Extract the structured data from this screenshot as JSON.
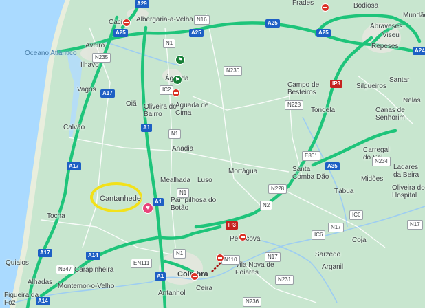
{
  "map": {
    "water_label": "Oceano Atlântico",
    "place_labels": [
      {
        "id": "caci",
        "text": "Caci"
      },
      {
        "id": "albergaria",
        "text": "Albergaria-a-Velha"
      },
      {
        "id": "aveiro",
        "text": "Aveiro"
      },
      {
        "id": "ilhavo",
        "text": "Ílhavo"
      },
      {
        "id": "vagos",
        "text": "Vagos"
      },
      {
        "id": "agueda",
        "text": "Águeda"
      },
      {
        "id": "oia",
        "text": "Oiã"
      },
      {
        "id": "oliveira_bairro",
        "text": "Oliveira do Bairro"
      },
      {
        "id": "aguada_cima",
        "text": "Aguada de Cima"
      },
      {
        "id": "calvao",
        "text": "Calvão"
      },
      {
        "id": "anadia",
        "text": "Anadia"
      },
      {
        "id": "cantanhede",
        "text": "Cantanhede"
      },
      {
        "id": "mealhada",
        "text": "Mealhada"
      },
      {
        "id": "luso",
        "text": "Luso"
      },
      {
        "id": "pampilhosa",
        "text": "Pampilhosa do Botão"
      },
      {
        "id": "mortagua",
        "text": "Mortágua"
      },
      {
        "id": "santa_comba",
        "text": "Santa Comba Dão"
      },
      {
        "id": "tocha",
        "text": "Tocha"
      },
      {
        "id": "penacova",
        "text": "Penacova"
      },
      {
        "id": "carapinheira",
        "text": "Carapinheira"
      },
      {
        "id": "quiaios",
        "text": "Quiaios"
      },
      {
        "id": "alhadas",
        "text": "Alhadas"
      },
      {
        "id": "montemor",
        "text": "Montemor-o-Velho"
      },
      {
        "id": "figueira",
        "text": "Figueira da Foz"
      },
      {
        "id": "coimbra",
        "text": "Coimbra"
      },
      {
        "id": "antanhol",
        "text": "Antanhol"
      },
      {
        "id": "ceira",
        "text": "Ceira"
      },
      {
        "id": "vila_nova",
        "text": "Vila Nova de Poiares"
      },
      {
        "id": "campo_besteiros",
        "text": "Campo de Besteiros"
      },
      {
        "id": "tondela",
        "text": "Tondela"
      },
      {
        "id": "silgueiros",
        "text": "Silgueiros"
      },
      {
        "id": "santar",
        "text": "Santar"
      },
      {
        "id": "nelas",
        "text": "Nelas"
      },
      {
        "id": "canas",
        "text": "Canas de Senhorim"
      },
      {
        "id": "carregal",
        "text": "Carregal do Sal"
      },
      {
        "id": "lagares",
        "text": "Lagares da Beira"
      },
      {
        "id": "oliveira_hospital",
        "text": "Oliveira do Hospital"
      },
      {
        "id": "midoes",
        "text": "Midões"
      },
      {
        "id": "tabua",
        "text": "Tábua"
      },
      {
        "id": "coja",
        "text": "Coja"
      },
      {
        "id": "sarzedo",
        "text": "Sarzedo"
      },
      {
        "id": "arganil",
        "text": "Arganil"
      },
      {
        "id": "bodiosa",
        "text": "Bodiosa"
      },
      {
        "id": "mundao",
        "text": "Mundão"
      },
      {
        "id": "abraveses",
        "text": "Abraveses"
      },
      {
        "id": "viseu",
        "text": "Viseu"
      },
      {
        "id": "repeses",
        "text": "Repeses"
      },
      {
        "id": "frades",
        "text": "Frades"
      }
    ],
    "road_shields": [
      {
        "id": "a29",
        "text": "A29",
        "style": "blue"
      },
      {
        "id": "a25a",
        "text": "A25",
        "style": "blue"
      },
      {
        "id": "a25b",
        "text": "A25",
        "style": "blue"
      },
      {
        "id": "a25c",
        "text": "A25",
        "style": "blue"
      },
      {
        "id": "a25d",
        "text": "A25",
        "style": "blue"
      },
      {
        "id": "a17a",
        "text": "A17",
        "style": "blue"
      },
      {
        "id": "a17b",
        "text": "A17",
        "style": "blue"
      },
      {
        "id": "a17c",
        "text": "A17",
        "style": "blue"
      },
      {
        "id": "a1a",
        "text": "A1",
        "style": "blue"
      },
      {
        "id": "a1b",
        "text": "A1",
        "style": "blue"
      },
      {
        "id": "a1c",
        "text": "A1",
        "style": "blue"
      },
      {
        "id": "a14a",
        "text": "A14",
        "style": "blue"
      },
      {
        "id": "a14b",
        "text": "A14",
        "style": "blue"
      },
      {
        "id": "a35",
        "text": "A35",
        "style": "blue"
      },
      {
        "id": "a24",
        "text": "A24",
        "style": "blue"
      },
      {
        "id": "ip3a",
        "text": "IP3",
        "style": "red"
      },
      {
        "id": "ip3b",
        "text": "IP3",
        "style": "red"
      },
      {
        "id": "n1a",
        "text": "N1",
        "style": "white"
      },
      {
        "id": "n1b",
        "text": "N1",
        "style": "white"
      },
      {
        "id": "n1c",
        "text": "N1",
        "style": "white"
      },
      {
        "id": "n1d",
        "text": "N1",
        "style": "white"
      },
      {
        "id": "n16",
        "text": "N16",
        "style": "white"
      },
      {
        "id": "n235",
        "text": "N235",
        "style": "white"
      },
      {
        "id": "n230",
        "text": "N230",
        "style": "white"
      },
      {
        "id": "ic2",
        "text": "IC2",
        "style": "white"
      },
      {
        "id": "n228a",
        "text": "N228",
        "style": "white"
      },
      {
        "id": "n228b",
        "text": "N228",
        "style": "white"
      },
      {
        "id": "e801",
        "text": "E801",
        "style": "white"
      },
      {
        "id": "n2",
        "text": "N2",
        "style": "white"
      },
      {
        "id": "n17a",
        "text": "N17",
        "style": "white"
      },
      {
        "id": "n17b",
        "text": "N17",
        "style": "white"
      },
      {
        "id": "n17c",
        "text": "N17",
        "style": "white"
      },
      {
        "id": "ic6a",
        "text": "IC6",
        "style": "white"
      },
      {
        "id": "ic6b",
        "text": "IC6",
        "style": "white"
      },
      {
        "id": "n234",
        "text": "N234",
        "style": "white"
      },
      {
        "id": "n347",
        "text": "N347",
        "style": "white"
      },
      {
        "id": "en111",
        "text": "EN111",
        "style": "white"
      },
      {
        "id": "n110",
        "text": "N110",
        "style": "white"
      },
      {
        "id": "n236",
        "text": "N236",
        "style": "white"
      },
      {
        "id": "n231",
        "text": "N231",
        "style": "white"
      }
    ],
    "colors": {
      "land": "#c8e6cf",
      "water": "#aadaff",
      "traffic_free": "#1ec47a",
      "highlight_circle": "#f2e11a"
    }
  }
}
